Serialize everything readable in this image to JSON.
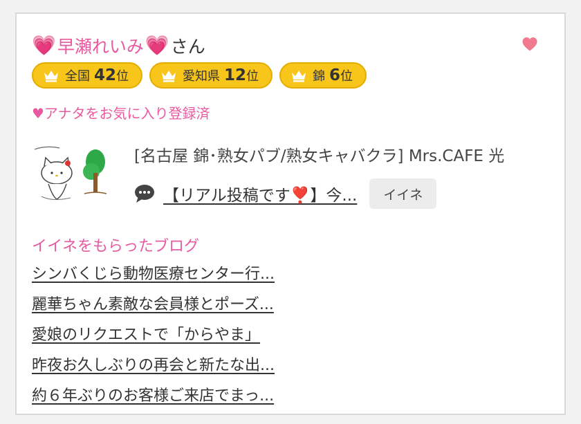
{
  "user": {
    "heart_left": "💗",
    "name": "早瀬れいみ",
    "heart_right": "💗",
    "suffix": "さん"
  },
  "favorite_icon": "heart-icon",
  "colors": {
    "pink": "#e85aa0",
    "gold": "#f8c51b",
    "gold_border": "#e4ac00",
    "heart": "#f07a8f"
  },
  "badges": [
    {
      "area": "全国",
      "rank": "42",
      "unit": "位"
    },
    {
      "area": "愛知県",
      "rank": "12",
      "unit": "位"
    },
    {
      "area": "錦",
      "rank": "6",
      "unit": "位"
    }
  ],
  "favorite_status": "♥アナタをお気に入り登録済",
  "shop": "[名古屋 錦･熟女パブ/熟女キャバクラ]  Mrs.CAFE 光",
  "post": {
    "icon": "speech-bubble-icon",
    "text": "【リアル投稿です❣️】今...",
    "like_button": "イイネ"
  },
  "liked_blogs": {
    "title": "イイネをもらったブログ",
    "items": [
      "シンバくじら動物医療センター行...",
      "麗華ちゃん素敵な会員様とポーズ...",
      "愛娘のリクエストで「からやま」",
      "昨夜お久しぶりの再会と新たな出...",
      "約６年ぶりのお客様ご来店でまっ..."
    ]
  }
}
